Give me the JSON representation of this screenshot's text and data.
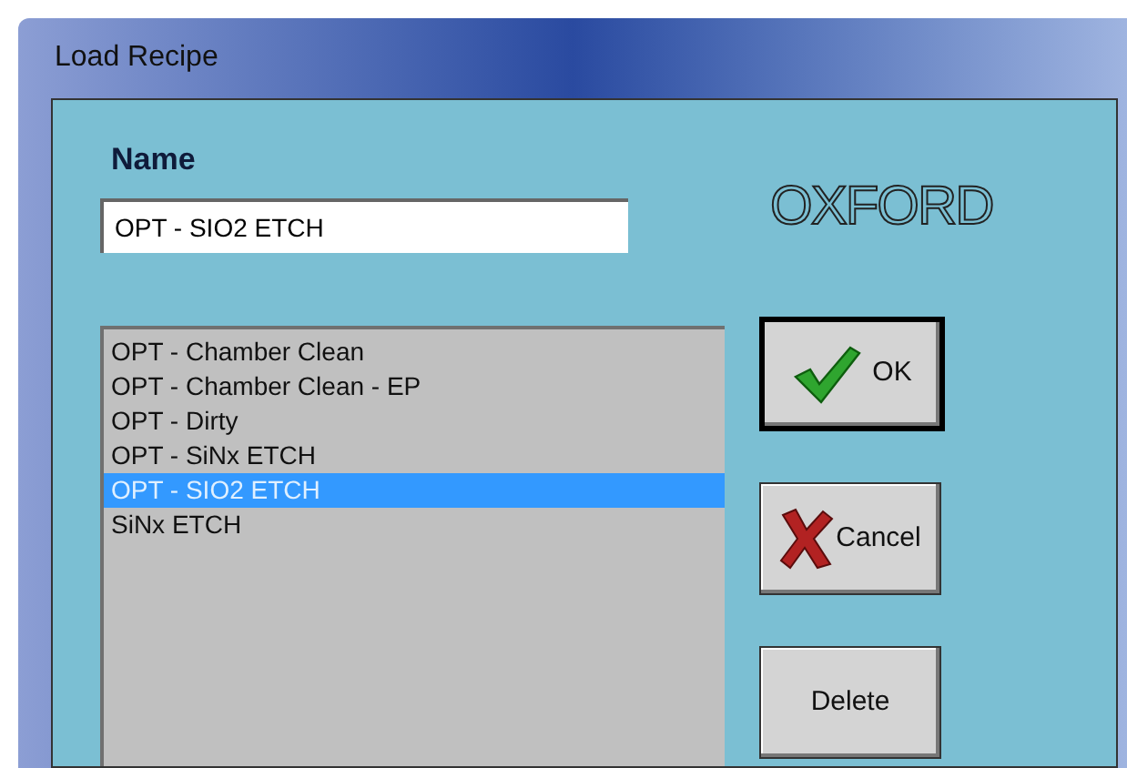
{
  "window": {
    "title": "Load Recipe"
  },
  "name_field": {
    "label": "Name",
    "value": "OPT - SIO2 ETCH"
  },
  "logo": "OXFORD",
  "recipes": [
    {
      "label": "OPT - Chamber Clean",
      "selected": false
    },
    {
      "label": "OPT - Chamber Clean - EP",
      "selected": false
    },
    {
      "label": "OPT - Dirty",
      "selected": false
    },
    {
      "label": "OPT - SiNx ETCH",
      "selected": false
    },
    {
      "label": "OPT - SIO2 ETCH",
      "selected": true
    },
    {
      "label": "SiNx ETCH",
      "selected": false
    }
  ],
  "buttons": [
    {
      "kind": "ok",
      "label": "OK",
      "default": true
    },
    {
      "kind": "cancel",
      "label": "Cancel",
      "default": false
    },
    {
      "kind": "delete",
      "label": "Delete",
      "default": false
    }
  ]
}
